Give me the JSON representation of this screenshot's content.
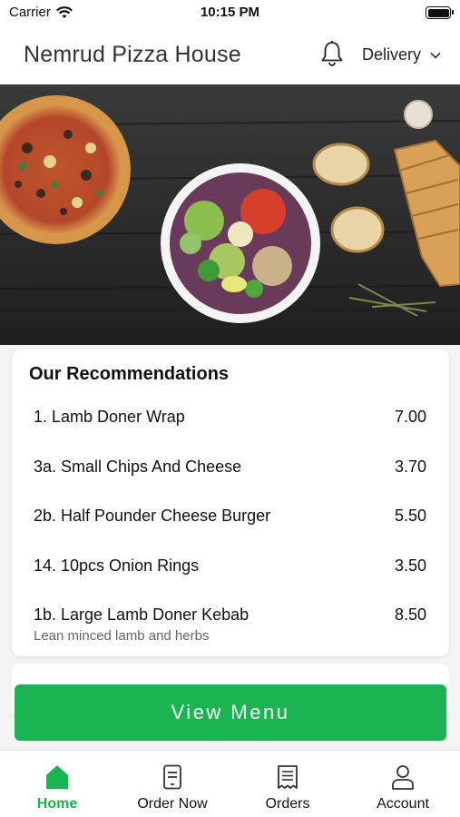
{
  "status_bar": {
    "carrier": "Carrier",
    "time": "10:15 PM"
  },
  "header": {
    "title": "Nemrud Pizza House",
    "delivery_label": "Delivery",
    "icons": [
      "bell-icon",
      "chevron-down-icon"
    ]
  },
  "recommendations": {
    "heading": "Our Recommendations",
    "items": [
      {
        "name": "1. Lamb Doner Wrap",
        "price": "7.00",
        "desc": ""
      },
      {
        "name": "3a. Small Chips And Cheese",
        "price": "3.70",
        "desc": ""
      },
      {
        "name": "2b. Half Pounder Cheese Burger",
        "price": "5.50",
        "desc": ""
      },
      {
        "name": "14. 10pcs Onion Rings",
        "price": "3.50",
        "desc": ""
      },
      {
        "name": "1b. Large Lamb Doner Kebab",
        "price": "8.50",
        "desc": "Lean minced lamb and herbs"
      }
    ]
  },
  "view_menu_label": "View Menu",
  "tabs": [
    {
      "label": "Home",
      "icon": "home-icon",
      "active": true
    },
    {
      "label": "Order Now",
      "icon": "order-now-icon",
      "active": false
    },
    {
      "label": "Orders",
      "icon": "orders-receipt-icon",
      "active": false
    },
    {
      "label": "Account",
      "icon": "account-icon",
      "active": false
    }
  ],
  "colors": {
    "accent": "#1ab550",
    "background": "#f3f3f3"
  }
}
